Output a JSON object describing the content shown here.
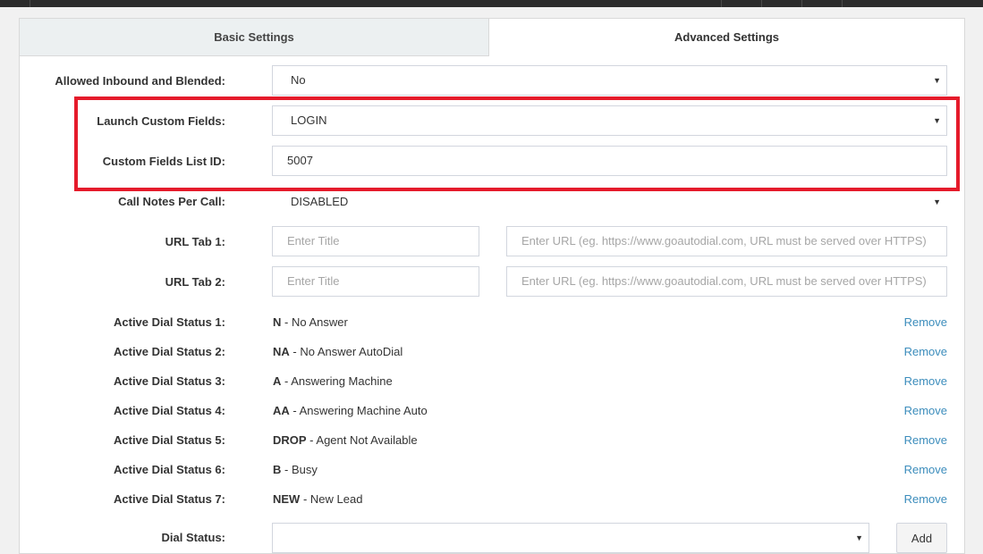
{
  "tabs": {
    "basic": "Basic Settings",
    "advanced": "Advanced Settings"
  },
  "settings": {
    "inbound_blended": {
      "label": "Allowed Inbound and Blended:",
      "value": "No"
    },
    "launch_custom_fields": {
      "label": "Launch Custom Fields:",
      "value": "LOGIN"
    },
    "custom_fields_list_id": {
      "label": "Custom Fields List ID:",
      "value": "5007"
    },
    "call_notes": {
      "label": "Call Notes Per Call:",
      "value": "DISABLED"
    },
    "url_tab_1": {
      "label": "URL Tab 1:",
      "title_placeholder": "Enter Title",
      "url_placeholder": "Enter URL (eg. https://www.goautodial.com, URL must be served over HTTPS)"
    },
    "url_tab_2": {
      "label": "URL Tab 2:",
      "title_placeholder": "Enter Title",
      "url_placeholder": "Enter URL (eg. https://www.goautodial.com, URL must be served over HTTPS)"
    }
  },
  "active_dial_statuses": [
    {
      "label": "Active Dial Status 1:",
      "code": "N",
      "desc": " - No Answer",
      "action": "Remove"
    },
    {
      "label": "Active Dial Status 2:",
      "code": "NA",
      "desc": " - No Answer AutoDial",
      "action": "Remove"
    },
    {
      "label": "Active Dial Status 3:",
      "code": "A",
      "desc": " - Answering Machine",
      "action": "Remove"
    },
    {
      "label": "Active Dial Status 4:",
      "code": "AA",
      "desc": " - Answering Machine Auto",
      "action": "Remove"
    },
    {
      "label": "Active Dial Status 5:",
      "code": "DROP",
      "desc": " - Agent Not Available",
      "action": "Remove"
    },
    {
      "label": "Active Dial Status 6:",
      "code": "B",
      "desc": " - Busy",
      "action": "Remove"
    },
    {
      "label": "Active Dial Status 7:",
      "code": "NEW",
      "desc": " - New Lead",
      "action": "Remove"
    }
  ],
  "dial_status": {
    "label": "Dial Status:",
    "value": "",
    "add_label": "Add"
  },
  "icons": {
    "dropdown": "caret-down-icon"
  },
  "colors": {
    "highlight": "#e51b2b",
    "link": "#3c8dbc",
    "tab_inactive": "#ecf0f1"
  }
}
